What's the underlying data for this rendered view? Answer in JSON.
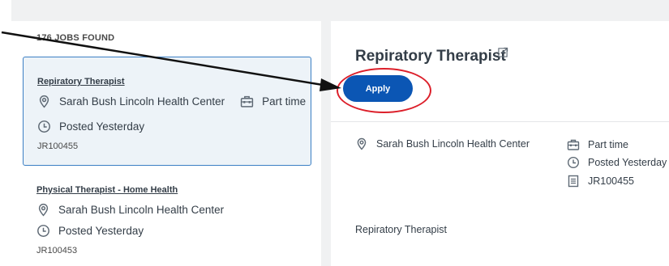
{
  "job_list": {
    "count_label": "176 JOBS FOUND",
    "jobs": [
      {
        "title": "Repiratory Therapist",
        "location": "Sarah Bush Lincoln Health Center",
        "time_type": "Part time",
        "posted": "Posted Yesterday",
        "req_id": "JR100455",
        "selected": true
      },
      {
        "title": "Physical Therapist - Home Health",
        "location": "Sarah Bush Lincoln Health Center",
        "posted": "Posted Yesterday",
        "req_id": "JR100453",
        "selected": false
      }
    ]
  },
  "detail": {
    "title": "Repiratory Therapist",
    "apply_label": "Apply",
    "location": "Sarah Bush Lincoln Health Center",
    "time_type": "Part time",
    "posted": "Posted Yesterday",
    "req_id": "JR100455",
    "description": "Repiratory Therapist"
  },
  "icons": {
    "location": "location-pin-icon",
    "time_type": "briefcase-icon",
    "posted": "clock-icon",
    "req_id": "document-icon",
    "external": "external-link-icon"
  },
  "colors": {
    "accent": "#0b56b4",
    "selected_border": "#3b7fc4",
    "selected_bg": "#edf3f8",
    "annotation": "#dc1f2a"
  }
}
